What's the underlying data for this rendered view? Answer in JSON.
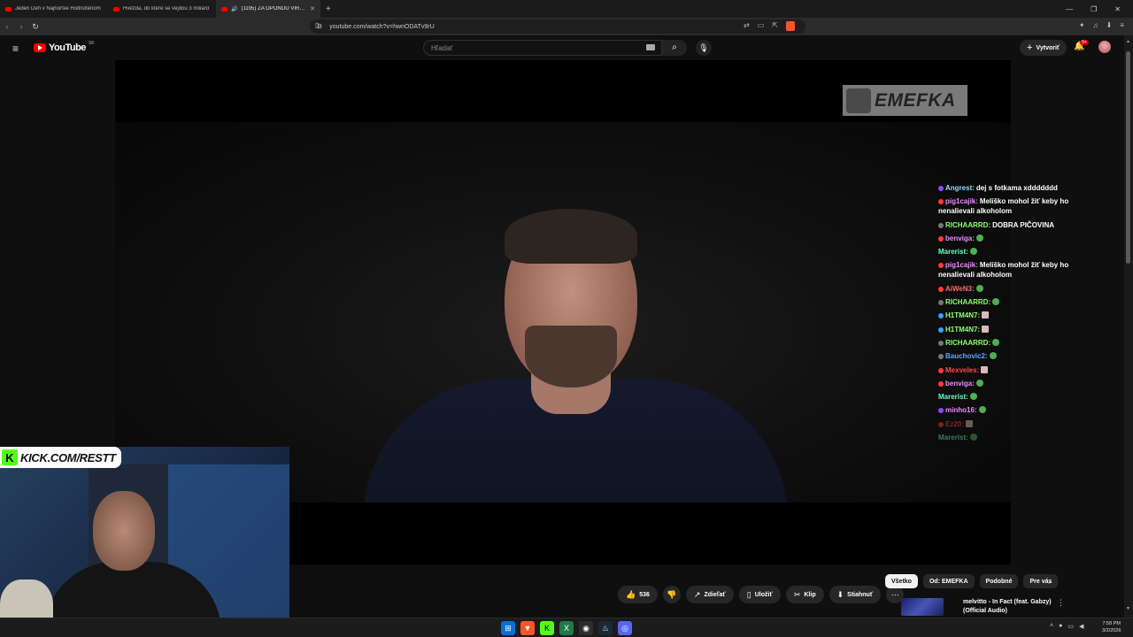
{
  "browser": {
    "tabs": [
      {
        "label": "Jeden Deň v Najhoršie Hodnotenom",
        "active": false
      },
      {
        "label": "Hvězda, do které se vejdou 3 miliard",
        "active": false
      },
      {
        "label": "(1195) ZA OPONOU VIRALITY",
        "active": true
      }
    ],
    "new_tab": "+",
    "url": "youtube.com/watch?v=hwnODATv9rU"
  },
  "youtube": {
    "logo_text": "YouTube",
    "region": "SK",
    "search_placeholder": "Hľadať",
    "create_label": "Vytvoriť",
    "notif_count": "9+"
  },
  "video": {
    "channel_watermark": "EMEFKA",
    "streamer_overlay": "KICK.COM/RESTT"
  },
  "chat": [
    {
      "user": "Angrest:",
      "text": "dej s fotkama xddddddd",
      "color": "#9ad7ff",
      "dot": "#8a4bff",
      "emote": ""
    },
    {
      "user": "pig1cajik:",
      "text": "Melíško mohol žiť keby ho nenalievali alkoholom",
      "color": "#e98bff",
      "dot": "#ff3b3b",
      "emote": ""
    },
    {
      "user": "RICHAARRD:",
      "text": "DOBRA PIČOVINA",
      "color": "#8cff6e",
      "dot": "#777",
      "emote": ""
    },
    {
      "user": "benviga:",
      "text": "",
      "color": "#e98bff",
      "dot": "#ff3b3b",
      "emote": "round"
    },
    {
      "user": "Marerist:",
      "text": "",
      "color": "#6effc2",
      "dot": "",
      "emote": "round"
    },
    {
      "user": "pig1cajik:",
      "text": "Melíško mohol žiť keby ho nenalievali alkoholom",
      "color": "#e98bff",
      "dot": "#ff3b3b",
      "emote": ""
    },
    {
      "user": "AiWeN3:",
      "text": "",
      "color": "#ff6b6b",
      "dot": "#ff3b3b",
      "emote": "round"
    },
    {
      "user": "RICHAARRD:",
      "text": "",
      "color": "#8cff6e",
      "dot": "#777",
      "emote": "round"
    },
    {
      "user": "H1TM4N7:",
      "text": "",
      "color": "#8cff6e",
      "dot": "#3ba0ff",
      "emote": "square"
    },
    {
      "user": "H1TM4N7:",
      "text": "",
      "color": "#8cff6e",
      "dot": "#3ba0ff",
      "emote": "square"
    },
    {
      "user": "RICHAARRD:",
      "text": "",
      "color": "#8cff6e",
      "dot": "#777",
      "emote": "round"
    },
    {
      "user": "Bauchovic2:",
      "text": "",
      "color": "#5aa8ff",
      "dot": "#777",
      "emote": "round"
    },
    {
      "user": "Mexveles:",
      "text": "",
      "color": "#ff4b4b",
      "dot": "#ff3b3b",
      "emote": "square"
    },
    {
      "user": "benviga:",
      "text": "",
      "color": "#e98bff",
      "dot": "#ff3b3b",
      "emote": "round"
    },
    {
      "user": "Marerist:",
      "text": "",
      "color": "#6effc2",
      "dot": "",
      "emote": "round"
    },
    {
      "user": "minho16:",
      "text": "",
      "color": "#e98bff",
      "dot": "#8a4bff",
      "emote": "round"
    },
    {
      "user": "Ez20:",
      "text": "",
      "color": "#ff4b4b",
      "dot": "#ff3b3b",
      "emote": "square"
    },
    {
      "user": "Marerist:",
      "text": "",
      "color": "#6effc2",
      "dot": "",
      "emote": "round"
    }
  ],
  "actions": {
    "like_count": "536",
    "share": "Zdieľať",
    "save": "Uložiť",
    "clip": "Klip",
    "download": "Stiahnuť"
  },
  "chips": [
    "Všetko",
    "Od: EMEFKA",
    "Podobné",
    "Pre vás"
  ],
  "recommended": {
    "title": "melvitto - In Fact (feat. Gabzy) (Official Audio)"
  },
  "taskbar": {
    "time": "7:58 PM",
    "date": "3/2/2026"
  }
}
